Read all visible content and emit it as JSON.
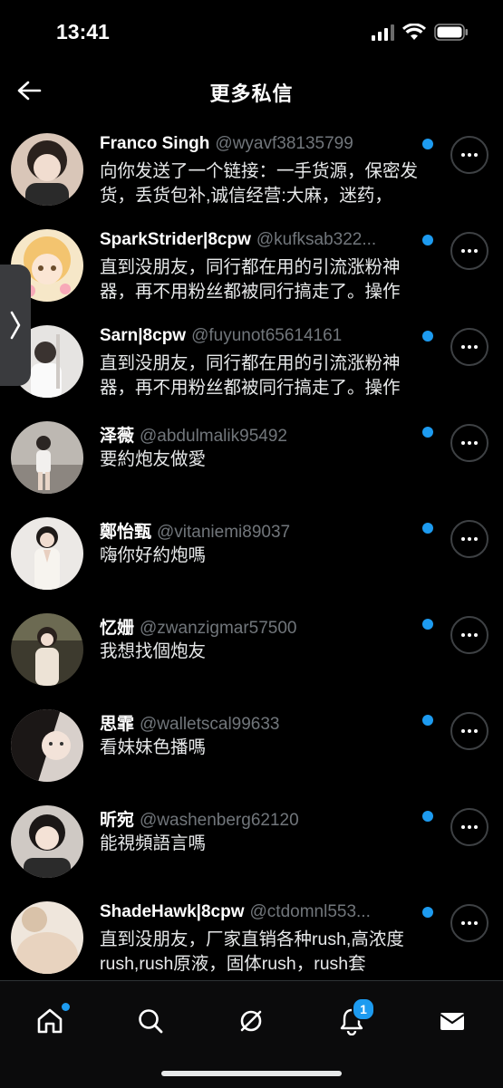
{
  "status_bar": {
    "time": "13:41"
  },
  "header": {
    "title": "更多私信"
  },
  "messages": [
    {
      "name": "Franco Singh",
      "handle": "@wyavf38135799",
      "preview": "向你发送了一个链接：一手货源，保密发货，丢货包补,诚信经营:大麻，迷药，"
    },
    {
      "name": "SparkStrider|8cpw",
      "handle": "@kufksab322...",
      "preview": "直到没朋友，同行都在用的引流涨粉神器，再不用粉丝都被同行搞走了。操作"
    },
    {
      "name": "Sarn|8cpw",
      "handle": "@fuyunot65614161",
      "preview": "直到没朋友，同行都在用的引流涨粉神器，再不用粉丝都被同行搞走了。操作"
    },
    {
      "name": "泽薇",
      "handle": "@abdulmalik95492",
      "preview": "要約炮友做愛"
    },
    {
      "name": "鄭怡甄",
      "handle": "@vitaniemi89037",
      "preview": "嗨你好約炮嗎"
    },
    {
      "name": "忆姗",
      "handle": "@zwanzigmar57500",
      "preview": "我想找個炮友"
    },
    {
      "name": "思霏",
      "handle": "@walletscal99633",
      "preview": "看妹妹色播嗎"
    },
    {
      "name": "昕宛",
      "handle": "@washenberg62120",
      "preview": "能視頻語言嗎"
    },
    {
      "name": "ShadeHawk|8cpw",
      "handle": "@ctdomnl553...",
      "preview": "直到没朋友，厂家直销各种rush,高浓度rush,rush原液，固体rush，rush套"
    }
  ],
  "bottom_nav": {
    "items": [
      "home",
      "search",
      "communities",
      "notifications",
      "messages"
    ],
    "notifications_badge": "1"
  },
  "colors": {
    "accent": "#1d9bf0",
    "background": "#000000",
    "muted": "#71767b"
  }
}
